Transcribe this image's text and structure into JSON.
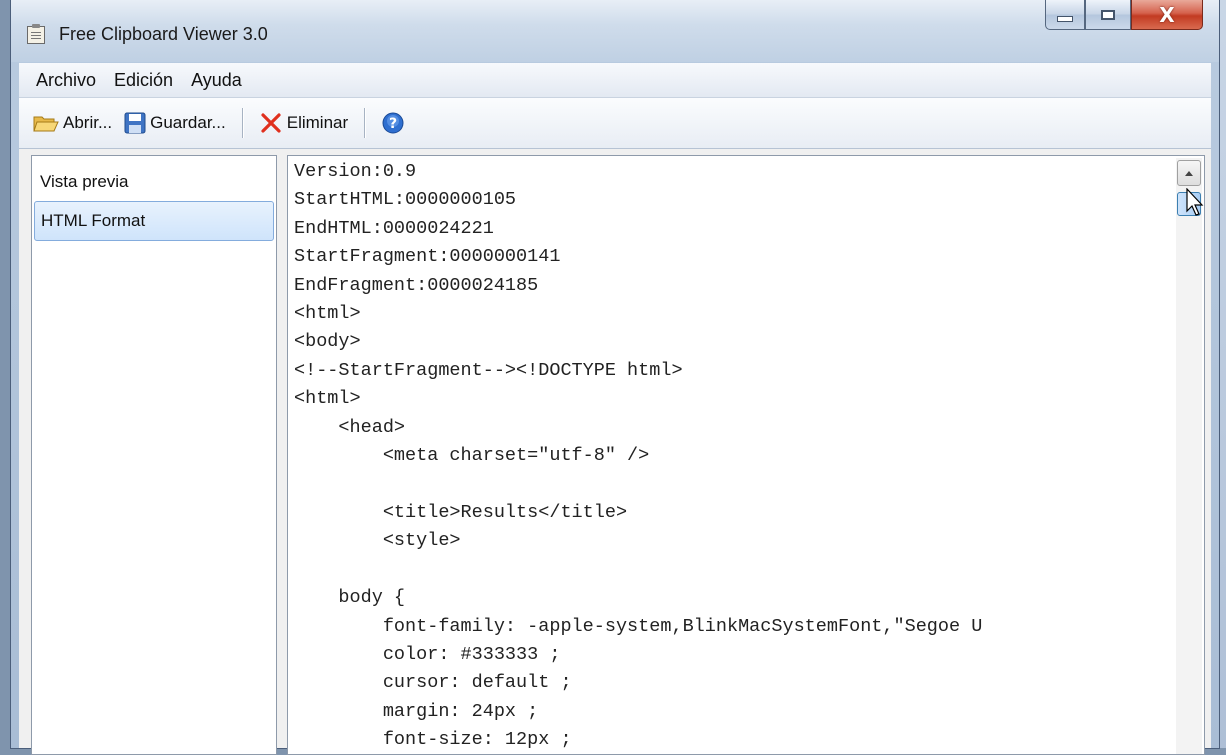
{
  "window": {
    "title": "Free Clipboard Viewer 3.0",
    "controls": {
      "minimize": "minimize",
      "maximize": "maximize",
      "close": "X"
    }
  },
  "menu": {
    "items": [
      "Archivo",
      "Edición",
      "Ayuda"
    ]
  },
  "toolbar": {
    "open_label": "Abrir...",
    "save_label": "Guardar...",
    "delete_label": "Eliminar",
    "help_icon": "help-icon"
  },
  "formats": {
    "items": [
      {
        "label": "Vista previa",
        "selected": false
      },
      {
        "label": "HTML Format",
        "selected": true
      }
    ]
  },
  "content": {
    "lines": [
      "Version:0.9",
      "StartHTML:0000000105",
      "EndHTML:0000024221",
      "StartFragment:0000000141",
      "EndFragment:0000024185",
      "<html>",
      "<body>",
      "<!--StartFragment--><!DOCTYPE html>",
      "<html>",
      "    <head>",
      "        <meta charset=\"utf-8\" />",
      "",
      "        <title>Results</title>",
      "        <style>",
      "",
      "    body {",
      "        font-family: -apple-system,BlinkMacSystemFont,\"Segoe U",
      "        color: #333333 ;",
      "        cursor: default ;",
      "        margin: 24px ;",
      "        font-size: 12px ;"
    ]
  },
  "colors": {
    "selection": "#cfe4fb",
    "close_button": "#c23b22",
    "chrome": "#bfd0e3"
  }
}
